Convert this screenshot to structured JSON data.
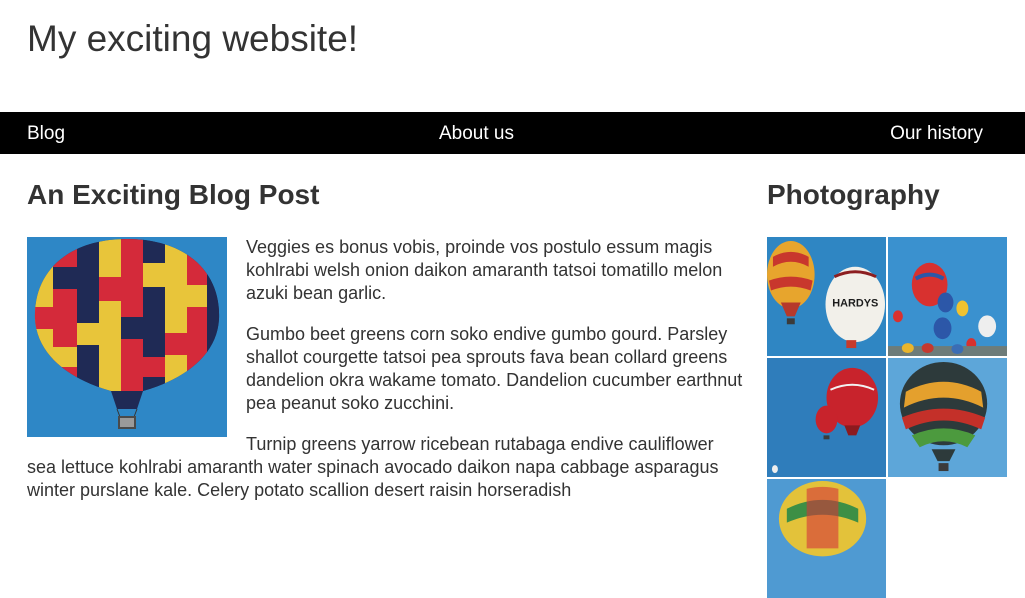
{
  "site": {
    "title": "My exciting website!"
  },
  "nav": {
    "items": [
      {
        "label": "Blog"
      },
      {
        "label": "About us"
      },
      {
        "label": "Our history"
      }
    ]
  },
  "post": {
    "title": "An Exciting Blog Post",
    "paragraphs": [
      "Veggies es bonus vobis, proinde vos postulo essum magis kohlrabi welsh onion daikon amaranth tatsoi tomatillo melon azuki bean garlic.",
      "Gumbo beet greens corn soko endive gumbo gourd. Parsley shallot courgette tatsoi pea sprouts fava bean collard greens dandelion okra wakame tomato. Dandelion cucumber earthnut pea peanut soko zucchini.",
      "Turnip greens yarrow ricebean rutabaga endive cauliflower sea lettuce kohlrabi amaranth water spinach avocado daikon napa cabbage asparagus winter purslane kale. Celery potato scallion desert raisin horseradish"
    ],
    "image_icon": "hot-air-balloon-photo"
  },
  "sidebar": {
    "title": "Photography",
    "photos": [
      {
        "icon": "hot-air-balloons-photo"
      },
      {
        "icon": "hot-air-balloons-photo",
        "label": "HARDYS"
      },
      {
        "icon": "hot-air-balloons-photo"
      },
      {
        "icon": "hot-air-balloons-photo"
      },
      {
        "icon": "hot-air-balloons-photo"
      }
    ]
  },
  "colors": {
    "text": "#333333",
    "nav_bg": "#000000",
    "nav_text": "#ffffff",
    "sky": "#2f86c3"
  }
}
